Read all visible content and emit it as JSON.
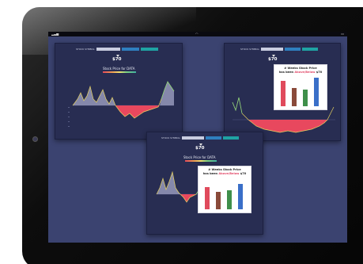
{
  "panel_top_left": {
    "ticker_label": "STOCK SYMBOL:",
    "price": "$70",
    "chart_title": "Stock Price for DATA",
    "buttons": [
      "",
      ""
    ]
  },
  "panel_top_right": {
    "ticker_label": "STOCK SYMBOL:",
    "price": "$70",
    "popup": {
      "line1": "# Weeks Stock Price",
      "line2_prefix": "has been ",
      "line2_highlight": "Above/Below",
      "line2_suffix": " $70",
      "bars": [
        {
          "color": "#e04a5c",
          "level": 0.85
        },
        {
          "color": "#8a4a3a",
          "level": 0.6
        },
        {
          "color": "#3f8f4a",
          "level": 0.55
        },
        {
          "color": "#3a6fc8",
          "level": 0.95
        }
      ]
    }
  },
  "panel_bottom": {
    "ticker_label": "STOCK SYMBOL:",
    "price": "$70",
    "chart_title": "Stock Price for DATA",
    "popup": {
      "line1": "# Weeks Stock Price",
      "line2_prefix": "has been ",
      "line2_highlight": "Above/Below",
      "line2_suffix": " $70",
      "bars": [
        {
          "color": "#e04a5c",
          "level": 0.7
        },
        {
          "color": "#8a4a3a",
          "level": 0.55
        },
        {
          "color": "#3f8f4a",
          "level": 0.6
        },
        {
          "color": "#3a6fc8",
          "level": 0.8
        }
      ]
    }
  },
  "colors": {
    "above_area": "#8a8db0",
    "below_area": "#e8485e",
    "line_high": "#7fd07f",
    "line_mid": "#e6d160"
  }
}
